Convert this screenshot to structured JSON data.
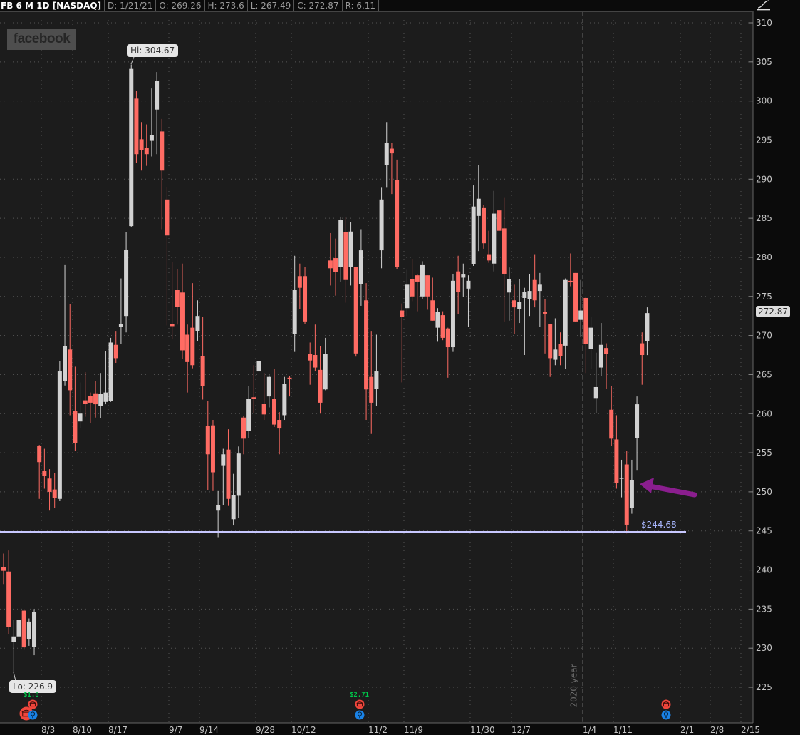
{
  "header": {
    "symbol": "FB 6 M 1D [NASDAQ]",
    "date": "D: 1/21/21",
    "open": "O: 269.26",
    "high": "H: 273.6",
    "low": "L: 267.49",
    "close": "C: 272.87",
    "range": "R: 6.11"
  },
  "logo_text": "facebook",
  "hi_label": "Hi: 304.67",
  "lo_label": "Lo: 226.9",
  "last_price": "272.87",
  "support_line_label": "$244.68",
  "year_label": "2020 year",
  "earnings": [
    {
      "label": "$1.8"
    },
    {
      "label": "$2.71"
    },
    {
      "label": ""
    }
  ],
  "colors": {
    "up": "#d2d2d2",
    "down": "#ff6b63",
    "support": "#c8c8ff",
    "arrow": "#8a1e8e",
    "background": "#1c1c1c"
  },
  "chart_data": {
    "type": "candlestick",
    "title": "FB 6 M 1D [NASDAQ]",
    "ylim": [
      220,
      312
    ],
    "y_ticks": [
      "310",
      "305",
      "300",
      "295",
      "290",
      "285",
      "280",
      "275",
      "270",
      "265",
      "260",
      "255",
      "250",
      "245",
      "240",
      "235",
      "230",
      "225"
    ],
    "x_ticks": [
      "8/3",
      "8/10",
      "8/17",
      "9/7",
      "9/14",
      "9/28",
      "10/12",
      "11/2",
      "11/9",
      "11/30",
      "12/7",
      "1/4",
      "1/11",
      "2/1",
      "2/8",
      "2/15"
    ],
    "support_level": 244.68,
    "ohlc": [
      [
        240.4,
        242.1,
        238.2,
        239.9
      ],
      [
        239.8,
        242.5,
        231.8,
        232.7
      ],
      [
        230.8,
        233.6,
        226.9,
        231.5
      ],
      [
        231.5,
        234.9,
        230.9,
        233.6
      ],
      [
        234.8,
        235.0,
        229.8,
        230.1
      ],
      [
        231.2,
        233.8,
        230.3,
        233.4
      ],
      [
        230.2,
        235.0,
        229.1,
        234.6
      ],
      [
        255.9,
        256.0,
        249.1,
        253.8
      ],
      [
        252.7,
        255.5,
        250.4,
        252.0
      ],
      [
        251.7,
        252.9,
        247.6,
        250.0
      ],
      [
        250.3,
        252.4,
        247.9,
        249.2
      ],
      [
        249.1,
        266.7,
        248.8,
        265.4
      ],
      [
        264.2,
        279.0,
        263.6,
        268.6
      ],
      [
        268.2,
        274.0,
        259.8,
        263.0
      ],
      [
        260.3,
        266.0,
        255.2,
        256.2
      ],
      [
        259.0,
        264.0,
        258.2,
        260.0
      ],
      [
        261.7,
        265.3,
        259.6,
        261.3
      ],
      [
        262.3,
        262.7,
        258.8,
        261.4
      ],
      [
        262.6,
        264.2,
        259.5,
        261.2
      ],
      [
        261.0,
        265.2,
        259.4,
        262.5
      ],
      [
        261.5,
        268.0,
        261.2,
        262.7
      ],
      [
        261.6,
        269.7,
        261.5,
        269.1
      ],
      [
        268.8,
        270.5,
        266.5,
        267.1
      ],
      [
        271.1,
        277.3,
        268.9,
        271.5
      ],
      [
        272.5,
        283.2,
        270.4,
        281.0
      ],
      [
        284.0,
        304.67,
        283.9,
        304.1
      ],
      [
        300.3,
        301.3,
        292.1,
        293.2
      ],
      [
        295.1,
        297.3,
        291.1,
        293.7
      ],
      [
        294.0,
        297.0,
        291.7,
        293.2
      ],
      [
        294.9,
        301.6,
        292.9,
        295.6
      ],
      [
        298.9,
        303.7,
        293.2,
        302.6
      ],
      [
        296.1,
        297.7,
        283.6,
        291.1
      ],
      [
        287.4,
        289.0,
        271.3,
        282.8
      ],
      [
        271.5,
        279.4,
        269.5,
        271.2
      ],
      [
        275.8,
        278.5,
        271.4,
        273.7
      ],
      [
        275.5,
        279.2,
        267.0,
        268.1
      ],
      [
        270.1,
        271.4,
        262.7,
        266.6
      ],
      [
        271.0,
        276.7,
        265.8,
        266.2
      ],
      [
        270.6,
        274.5,
        269.3,
        272.5
      ],
      [
        267.4,
        272.4,
        261.8,
        263.5
      ],
      [
        258.4,
        261.6,
        250.2,
        254.8
      ],
      [
        258.5,
        259.2,
        250.1,
        252.5
      ],
      [
        247.6,
        250.1,
        244.2,
        248.3
      ],
      [
        253.4,
        255.5,
        248.3,
        254.8
      ],
      [
        255.4,
        258.0,
        248.2,
        249.1
      ],
      [
        246.5,
        252.3,
        245.7,
        249.6
      ],
      [
        249.5,
        255.8,
        246.7,
        254.9
      ],
      [
        259.5,
        259.7,
        254.8,
        256.8
      ],
      [
        257.8,
        263.5,
        256.9,
        261.9
      ],
      [
        262.1,
        266.2,
        260.1,
        261.9
      ],
      [
        265.4,
        268.3,
        264.8,
        266.7
      ],
      [
        261.3,
        265.2,
        259.2,
        259.9
      ],
      [
        262.2,
        264.9,
        260.8,
        264.7
      ],
      [
        261.9,
        265.7,
        258.3,
        258.6
      ],
      [
        259.2,
        260.2,
        254.8,
        258.1
      ],
      [
        259.8,
        264.7,
        259.2,
        263.8
      ],
      [
        264.6,
        264.8,
        262.2,
        264.5
      ],
      [
        270.2,
        280.2,
        267.9,
        275.8
      ],
      [
        277.6,
        279.2,
        273.4,
        276.1
      ],
      [
        277.6,
        278.8,
        271.5,
        271.8
      ],
      [
        267.6,
        269.1,
        263.7,
        266.8
      ],
      [
        267.5,
        271.4,
        265.4,
        265.9
      ],
      [
        265.6,
        268.6,
        260.0,
        261.4
      ],
      [
        263.1,
        269.7,
        263.0,
        267.6
      ],
      [
        279.6,
        283.1,
        276.4,
        278.6
      ],
      [
        279.9,
        282.4,
        275.1,
        278.1
      ],
      [
        278.8,
        285.2,
        276.9,
        284.8
      ],
      [
        283.2,
        285.2,
        274.2,
        277.1
      ],
      [
        278.8,
        284.5,
        276.4,
        283.3
      ],
      [
        278.8,
        278.8,
        267.3,
        267.7
      ],
      [
        276.6,
        283.6,
        273.8,
        280.9
      ],
      [
        274.5,
        276.7,
        259.2,
        263.1
      ],
      [
        264.7,
        270.5,
        257.4,
        261.4
      ],
      [
        263.2,
        270.1,
        261.0,
        265.4
      ],
      [
        280.9,
        288.9,
        278.6,
        287.4
      ],
      [
        291.8,
        297.3,
        288.9,
        294.6
      ],
      [
        293.9,
        294.6,
        288.1,
        293.3
      ],
      [
        289.9,
        292.5,
        278.5,
        278.8
      ],
      [
        273.2,
        274.1,
        264.0,
        272.4
      ],
      [
        273.5,
        278.4,
        272.5,
        276.5
      ],
      [
        277.2,
        279.8,
        274.4,
        275.0
      ],
      [
        277.7,
        277.8,
        273.1,
        276.9
      ],
      [
        275.0,
        279.5,
        274.7,
        279.0
      ],
      [
        277.7,
        277.7,
        273.3,
        275.0
      ],
      [
        274.5,
        277.4,
        271.9,
        271.9
      ],
      [
        271.0,
        273.5,
        269.2,
        273.0
      ],
      [
        272.6,
        273.1,
        269.4,
        269.7
      ],
      [
        270.9,
        271.0,
        264.6,
        268.5
      ],
      [
        268.5,
        277.9,
        267.9,
        277.0
      ],
      [
        278.2,
        280.2,
        272.7,
        275.6
      ],
      [
        277.4,
        279.2,
        274.9,
        277.8
      ],
      [
        276.0,
        277.7,
        271.1,
        277.0
      ],
      [
        279.1,
        289.2,
        278.9,
        286.5
      ],
      [
        285.3,
        291.8,
        280.8,
        287.5
      ],
      [
        286.3,
        286.7,
        281.1,
        281.8
      ],
      [
        280.4,
        283.4,
        279.3,
        279.6
      ],
      [
        279.2,
        288.5,
        278.2,
        285.6
      ],
      [
        286.0,
        286.4,
        281.5,
        283.4
      ],
      [
        283.7,
        287.6,
        271.8,
        277.9
      ],
      [
        275.5,
        278.7,
        271.9,
        277.2
      ],
      [
        274.5,
        276.5,
        270.2,
        273.6
      ],
      [
        273.4,
        277.2,
        271.6,
        274.3
      ],
      [
        274.8,
        276.1,
        267.5,
        275.6
      ],
      [
        274.7,
        277.9,
        272.5,
        275.7
      ],
      [
        277.1,
        280.4,
        273.6,
        274.5
      ],
      [
        275.7,
        278.0,
        271.1,
        276.5
      ],
      [
        273.0,
        274.7,
        267.7,
        272.8
      ],
      [
        271.5,
        271.5,
        264.7,
        267.1
      ],
      [
        266.9,
        272.2,
        266.2,
        268.2
      ],
      [
        268.9,
        270.4,
        266.2,
        267.4
      ],
      [
        268.7,
        277.3,
        265.7,
        277.1
      ],
      [
        277.0,
        280.5,
        276.3,
        276.8
      ],
      [
        278.0,
        278.0,
        271.7,
        271.8
      ],
      [
        272.0,
        277.1,
        269.8,
        273.2
      ],
      [
        274.8,
        275.0,
        265.2,
        268.9
      ],
      [
        268.3,
        272.4,
        265.7,
        271.0
      ],
      [
        262.0,
        267.8,
        260.1,
        263.4
      ],
      [
        265.9,
        271.6,
        264.8,
        268.8
      ],
      [
        268.4,
        269.0,
        263.2,
        267.6
      ],
      [
        260.5,
        263.5,
        255.9,
        256.8
      ],
      [
        256.7,
        259.8,
        250.4,
        251.1
      ],
      [
        251.7,
        254.1,
        249.3,
        251.8
      ],
      [
        253.5,
        255.2,
        244.68,
        245.8
      ],
      [
        247.9,
        254.1,
        247.2,
        251.5
      ],
      [
        256.9,
        262.2,
        252.8,
        261.2
      ],
      [
        269.0,
        270.4,
        263.7,
        267.5
      ],
      [
        269.26,
        273.6,
        267.49,
        272.87
      ]
    ]
  }
}
